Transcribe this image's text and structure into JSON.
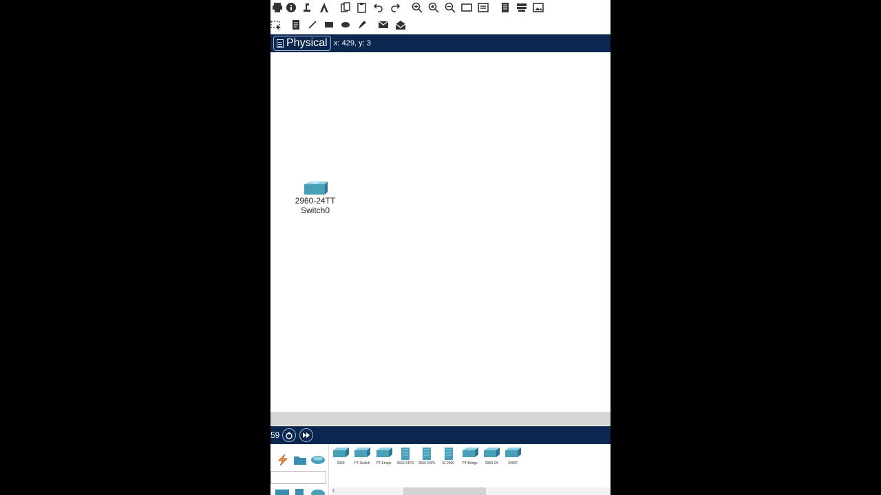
{
  "toolbar_top": {
    "icons": [
      "print-icon",
      "info-icon",
      "network-wizard-icon",
      "activity-wizard-icon",
      "copy-icon",
      "paste-icon",
      "undo-icon",
      "redo-icon",
      "zoom-in-icon",
      "zoom-reset-icon",
      "zoom-out-icon",
      "drawing-palette-icon",
      "custom-device-icon",
      "view-icon",
      "cluster-icon",
      "screenshot-icon"
    ]
  },
  "toolbar_second": {
    "icons": [
      "select-icon",
      "note-icon",
      "line-icon",
      "rectangle-icon",
      "ellipse-icon",
      "freeform-icon",
      "simple-pdu-icon",
      "complex-pdu-icon"
    ]
  },
  "mode_bar": {
    "mode_label": "Physical",
    "coords": "x: 429, y: 3"
  },
  "canvas": {
    "device": {
      "model": "2960-24TT",
      "name": "Switch0",
      "icon": "switch-icon"
    }
  },
  "sim_bar": {
    "time_label": "59",
    "icons": [
      "power-cycle-icon",
      "fast-forward-icon"
    ]
  },
  "palette": {
    "categories": [
      "connections-icon",
      "end-devices-icon",
      "components-icon"
    ],
    "bottom_icons": [
      "network-devices-icon",
      "multiuser-icon",
      "misc-icon"
    ],
    "filter_value": "",
    "devices": [
      {
        "label": "2960",
        "icon": "switch-icon"
      },
      {
        "label": "PT-Switch",
        "icon": "switch-icon"
      },
      {
        "label": "PT-Empty",
        "icon": "switch-icon"
      },
      {
        "label": "3560 24PS",
        "icon": "multilayer-switch-icon"
      },
      {
        "label": "3650 24PS",
        "icon": "multilayer-switch-icon"
      },
      {
        "label": "IE 2000",
        "icon": "industrial-switch-icon"
      },
      {
        "label": "PT-Bridge",
        "icon": "bridge-icon"
      },
      {
        "label": "2950-24",
        "icon": "switch-icon"
      },
      {
        "label": "2950T",
        "icon": "switch-icon"
      }
    ]
  },
  "colors": {
    "bar_bg": "#0b2750",
    "device_teal": "#4a9fb8"
  }
}
